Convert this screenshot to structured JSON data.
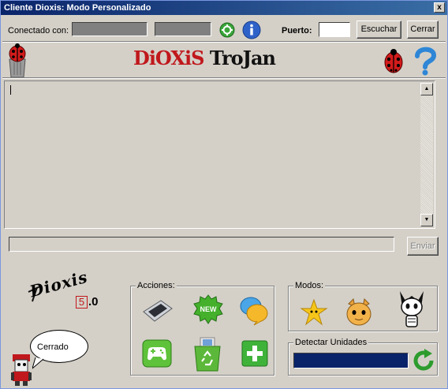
{
  "window": {
    "title": "Cliente Dioxis: Modo Personalizado",
    "close_glyph": "x"
  },
  "toolbar": {
    "connected_label": "Conectado con:",
    "port_label": "Puerto:",
    "port_value": "",
    "listen_label": "Escuchar",
    "close_label": "Cerrar"
  },
  "header": {
    "logo_part1": "DiOXiS",
    "logo_part2": "TroJan"
  },
  "console": {
    "text": ""
  },
  "send": {
    "input_value": "",
    "button_label": "Enviar"
  },
  "brand": {
    "name": "Dioxis",
    "version_major": "5",
    "version_minor": ".0"
  },
  "status": {
    "text": "Cerrado"
  },
  "actions": {
    "legend": "Acciones:"
  },
  "modes": {
    "legend": "Modos:"
  },
  "drives": {
    "legend": "Detectar Unidades",
    "progress": 1.0
  },
  "colors": {
    "title_bar": "#0a246a",
    "progress": "#0a246a",
    "accent_red": "#c0181c"
  }
}
